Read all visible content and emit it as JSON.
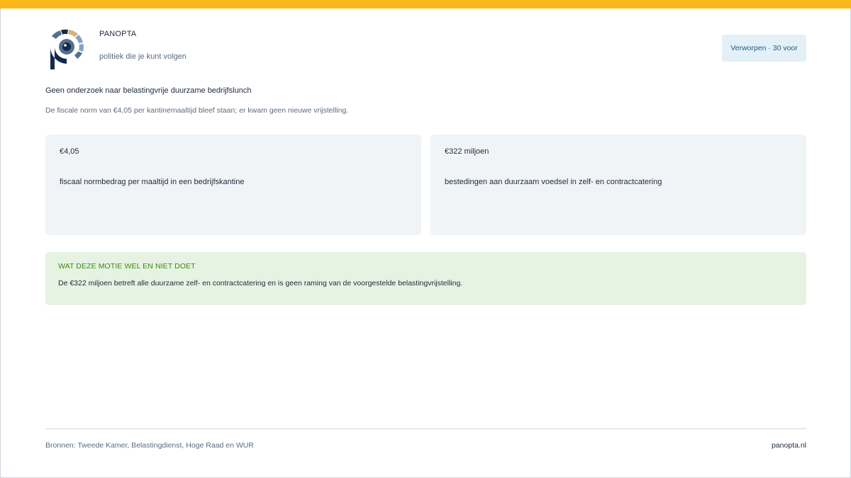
{
  "colors": {
    "accent_bar": "#fbb81b",
    "badge_bg": "#e4f0f7",
    "badge_text": "#1f5a84",
    "card_bg": "#f1f4f7",
    "note_bg": "#e6f2e2",
    "note_label": "#3d8a12",
    "logo_navy": "#15294a",
    "logo_tan": "#d2b27a",
    "logo_blue": "#8aa2bf",
    "logo_slate": "#55708f"
  },
  "header": {
    "brand": "PANOPTA",
    "tagline": "politiek die je kunt volgen",
    "logo_icon": "panopta-eye-logo-icon",
    "status": "Verworpen · 30 voor"
  },
  "motion": {
    "title": "Geen onderzoek naar belastingvrije duurzame bedrijfslunch",
    "summary": "De fiscale norm van €4,05 per kantinemaaltijd bleef staan; er kwam geen nieuwe vrijstelling."
  },
  "stats": [
    {
      "value": "€4,05",
      "description": "fiscaal normbedrag per maaltijd in een bedrijfskantine"
    },
    {
      "value": "€322 miljoen",
      "description": "bestedingen aan duurzaam voedsel in zelf- en contractcatering"
    }
  ],
  "note": {
    "label": "WAT DEZE MOTIE WEL EN NIET DOET",
    "text": "De €322 miljoen betreft alle duurzame zelf- en contractcatering en is geen raming van de voorgestelde belastingvrijstelling."
  },
  "footer": {
    "sources": "Bronnen: Tweede Kamer, Belastingdienst, Hoge Raad en WUR",
    "site": "panopta.nl"
  }
}
